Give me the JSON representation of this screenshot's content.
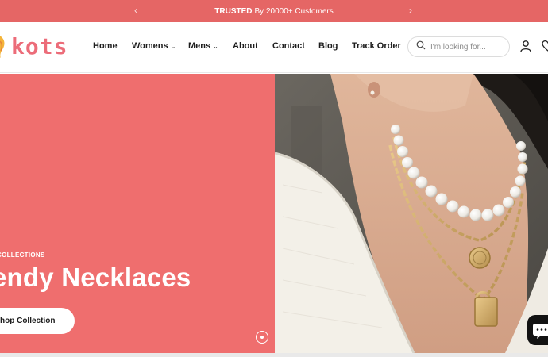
{
  "announcement": {
    "strong": "TRUSTED",
    "text": "By 20000+ Customers",
    "prev_icon": "chevron-left-icon",
    "next_icon": "chevron-right-icon",
    "bg_color": "#e56665"
  },
  "brand": {
    "name": "kots",
    "color": "#ec6c79"
  },
  "nav": {
    "items": [
      {
        "label": "Home"
      },
      {
        "label": "Womens",
        "has_dropdown": true
      },
      {
        "label": "Mens",
        "has_dropdown": true
      },
      {
        "label": "About"
      },
      {
        "label": "Contact"
      },
      {
        "label": "Blog"
      },
      {
        "label": "Track Order"
      }
    ]
  },
  "search": {
    "placeholder": "I'm looking for...",
    "icon": "search-icon"
  },
  "header_icons": [
    "account-icon",
    "wishlist-heart-icon"
  ],
  "hero": {
    "eyebrow": "COLLECTIONS",
    "headline": "endy Necklaces",
    "cta": "hop Collection",
    "bg_color": "#ef6e6e",
    "image": "woman-wearing-pearl-and-gold-chain-necklaces"
  },
  "chat": {
    "icon": "chat-bubble-icon"
  }
}
